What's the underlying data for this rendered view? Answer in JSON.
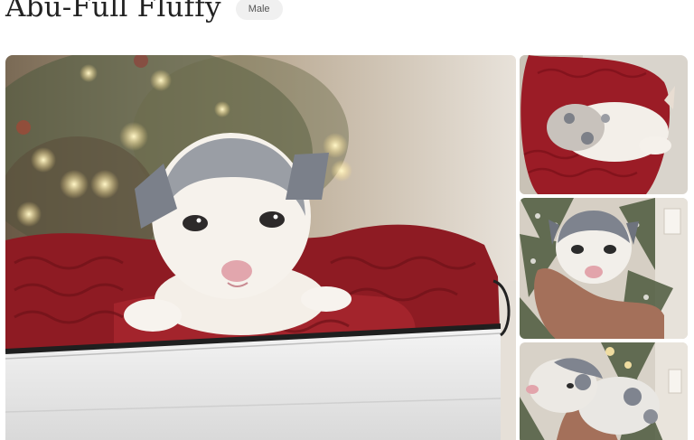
{
  "listing": {
    "title": "Abu-Full Fluffy",
    "sex_badge": "Male"
  },
  "gallery": {
    "images": [
      {
        "name": "puppy-photo-main"
      },
      {
        "name": "puppy-photo-thumb-1"
      },
      {
        "name": "puppy-photo-thumb-2"
      },
      {
        "name": "puppy-photo-thumb-3"
      }
    ]
  }
}
